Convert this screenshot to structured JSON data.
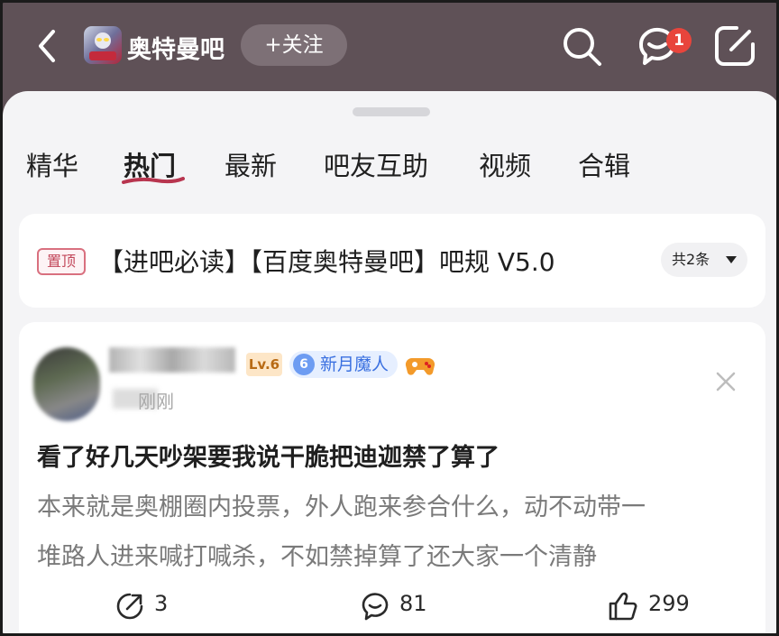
{
  "header": {
    "forum_name": "奥特曼吧",
    "follow_label": "+关注",
    "message_badge": "1"
  },
  "tabs": [
    {
      "label": "精华"
    },
    {
      "label": "热门"
    },
    {
      "label": "最新"
    },
    {
      "label": "吧友互助"
    },
    {
      "label": "视频"
    },
    {
      "label": "合辑"
    }
  ],
  "active_tab": "热门",
  "pinned": {
    "tag": "置顶",
    "title": "【进吧必读】【百度奥特曼吧】吧规 V5.0",
    "count_label": "共2条"
  },
  "post": {
    "level": "Lv.6",
    "title_level": "6",
    "title_badge": "新月魔人",
    "time": "刚刚",
    "title": "看了好几天吵架要我说干脆把迪迦禁了算了",
    "body_line1": "本来就是奥棚圈内投票，外人跑来参合什么，动不动带一",
    "body_line2": "堆路人进来喊打喊杀，不如禁掉算了还大家一个清静",
    "share_count": "3",
    "comment_count": "81",
    "like_count": "299"
  },
  "colors": {
    "header_bg": "#5f5157",
    "badge_red": "#e8453c",
    "tab_underline": "#b8354f",
    "level_badge": "#fde6c7",
    "title_badge": "#e6efff"
  }
}
